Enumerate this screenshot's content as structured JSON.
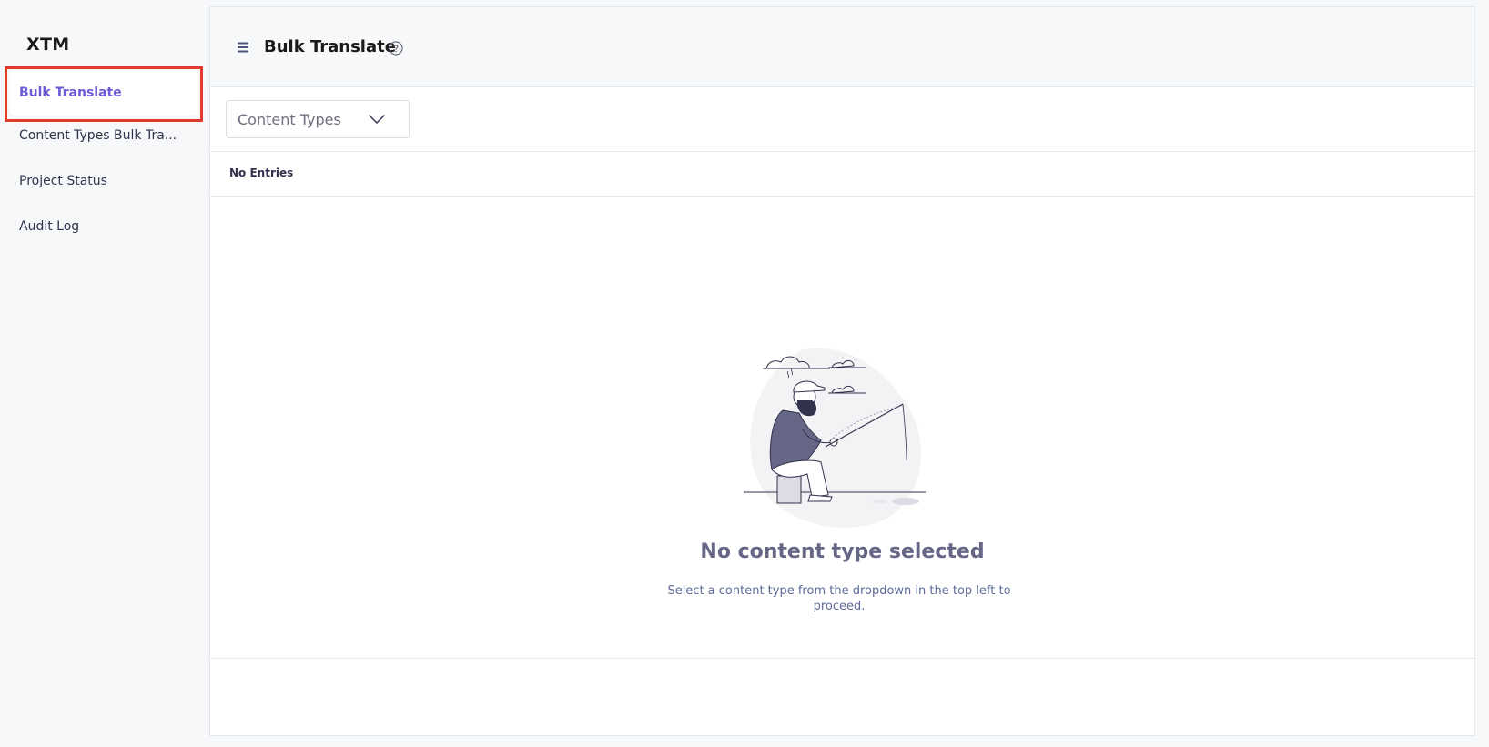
{
  "sidebar": {
    "brand": "XTM",
    "items": [
      {
        "label": "Bulk Translate",
        "active": true
      },
      {
        "label": "Content Types Bulk Tra..."
      },
      {
        "label": "Project Status"
      },
      {
        "label": "Audit Log"
      }
    ]
  },
  "header": {
    "title": "Bulk Translate",
    "menu_icon": "hamburger-icon",
    "help_icon": "question-circle-icon"
  },
  "toolbar": {
    "select_value": "Content Types",
    "select_icon": "chevron-down-icon"
  },
  "entries": {
    "label": "No Entries"
  },
  "empty_state": {
    "title": "No content type selected",
    "description": "Select a content type from the dropdown in the top left to proceed.",
    "illustration": "fishing-man-illustration"
  },
  "colors": {
    "accent": "#6b5bd6",
    "highlight_border": "#e23a2c",
    "background": "#f6f8fa"
  }
}
